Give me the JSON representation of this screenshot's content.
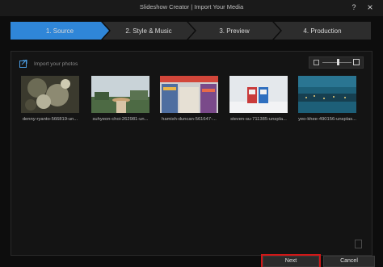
{
  "window": {
    "title": "Slideshow Creator | Import Your Media",
    "help_icon": "?",
    "close_icon": "×"
  },
  "steps": [
    {
      "label": "1. Source",
      "active": true
    },
    {
      "label": "2. Style & Music",
      "active": false
    },
    {
      "label": "3. Preview",
      "active": false
    },
    {
      "label": "4. Production",
      "active": false
    }
  ],
  "import": {
    "label": "Import your photos"
  },
  "photos": [
    {
      "caption": "denny-ryanto-566819-un..."
    },
    {
      "caption": "suhyeon-choi-262981-un..."
    },
    {
      "caption": "hamish-duncan-561647-..."
    },
    {
      "caption": "steven-su-711385-unspla..."
    },
    {
      "caption": "yeo-khee-490156-unsplas..."
    }
  ],
  "buttons": {
    "next": "Next",
    "cancel": "Cancel"
  },
  "colors": {
    "active_step": "#2f86d8",
    "inactive_step": "#2d2d2d",
    "highlight": "#d01818"
  }
}
